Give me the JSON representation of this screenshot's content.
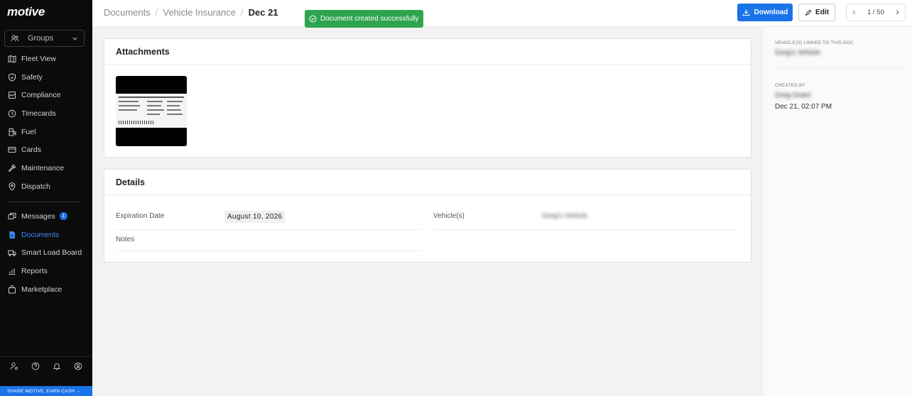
{
  "app": {
    "logo": "motive"
  },
  "sidebar": {
    "groups_label": "Groups",
    "primary_items": [
      {
        "label": "Fleet View",
        "icon": "map-icon"
      },
      {
        "label": "Safety",
        "icon": "shield-icon"
      },
      {
        "label": "Compliance",
        "icon": "compliance-icon"
      },
      {
        "label": "Timecards",
        "icon": "clock-icon"
      },
      {
        "label": "Fuel",
        "icon": "fuel-icon"
      },
      {
        "label": "Cards",
        "icon": "card-icon"
      },
      {
        "label": "Maintenance",
        "icon": "wrench-icon"
      },
      {
        "label": "Dispatch",
        "icon": "dispatch-icon"
      }
    ],
    "secondary_items": [
      {
        "label": "Messages",
        "icon": "messages-icon",
        "badge": "1"
      },
      {
        "label": "Documents",
        "icon": "document-icon",
        "active": true
      },
      {
        "label": "Smart Load Board",
        "icon": "truck-icon"
      },
      {
        "label": "Reports",
        "icon": "reports-icon"
      },
      {
        "label": "Marketplace",
        "icon": "bag-icon"
      }
    ],
    "bottom_icons": [
      "user-settings-icon",
      "help-icon",
      "bell-icon",
      "account-icon"
    ],
    "share_banner": "SHARE MOTIVE, EARN CASH →"
  },
  "header": {
    "breadcrumb": [
      "Documents",
      "Vehicle Insurance",
      "Dec 21"
    ],
    "toast": "Document created successfully",
    "download_label": "Download",
    "edit_label": "Edit",
    "pager": "1 / 50"
  },
  "attachments": {
    "title": "Attachments"
  },
  "details": {
    "title": "Details",
    "expiration_label": "Expiration Date",
    "expiration_value": "August 10, 2026",
    "vehicles_label": "Vehicle(s)",
    "vehicles_value": "Greg's Vehicle",
    "notes_label": "Notes"
  },
  "right_panel": {
    "linked_label": "VEHICLE(S) LINKED TO THIS DOC",
    "linked_value": "Greg's Vehicle",
    "created_by_label": "CREATED BY",
    "created_by_value": "Greg Grant",
    "created_at": "Dec 21, 02:07 PM"
  },
  "colors": {
    "accent": "#1a73e8",
    "success": "#2ea44f",
    "sidebar_bg": "#0b0b0b"
  }
}
